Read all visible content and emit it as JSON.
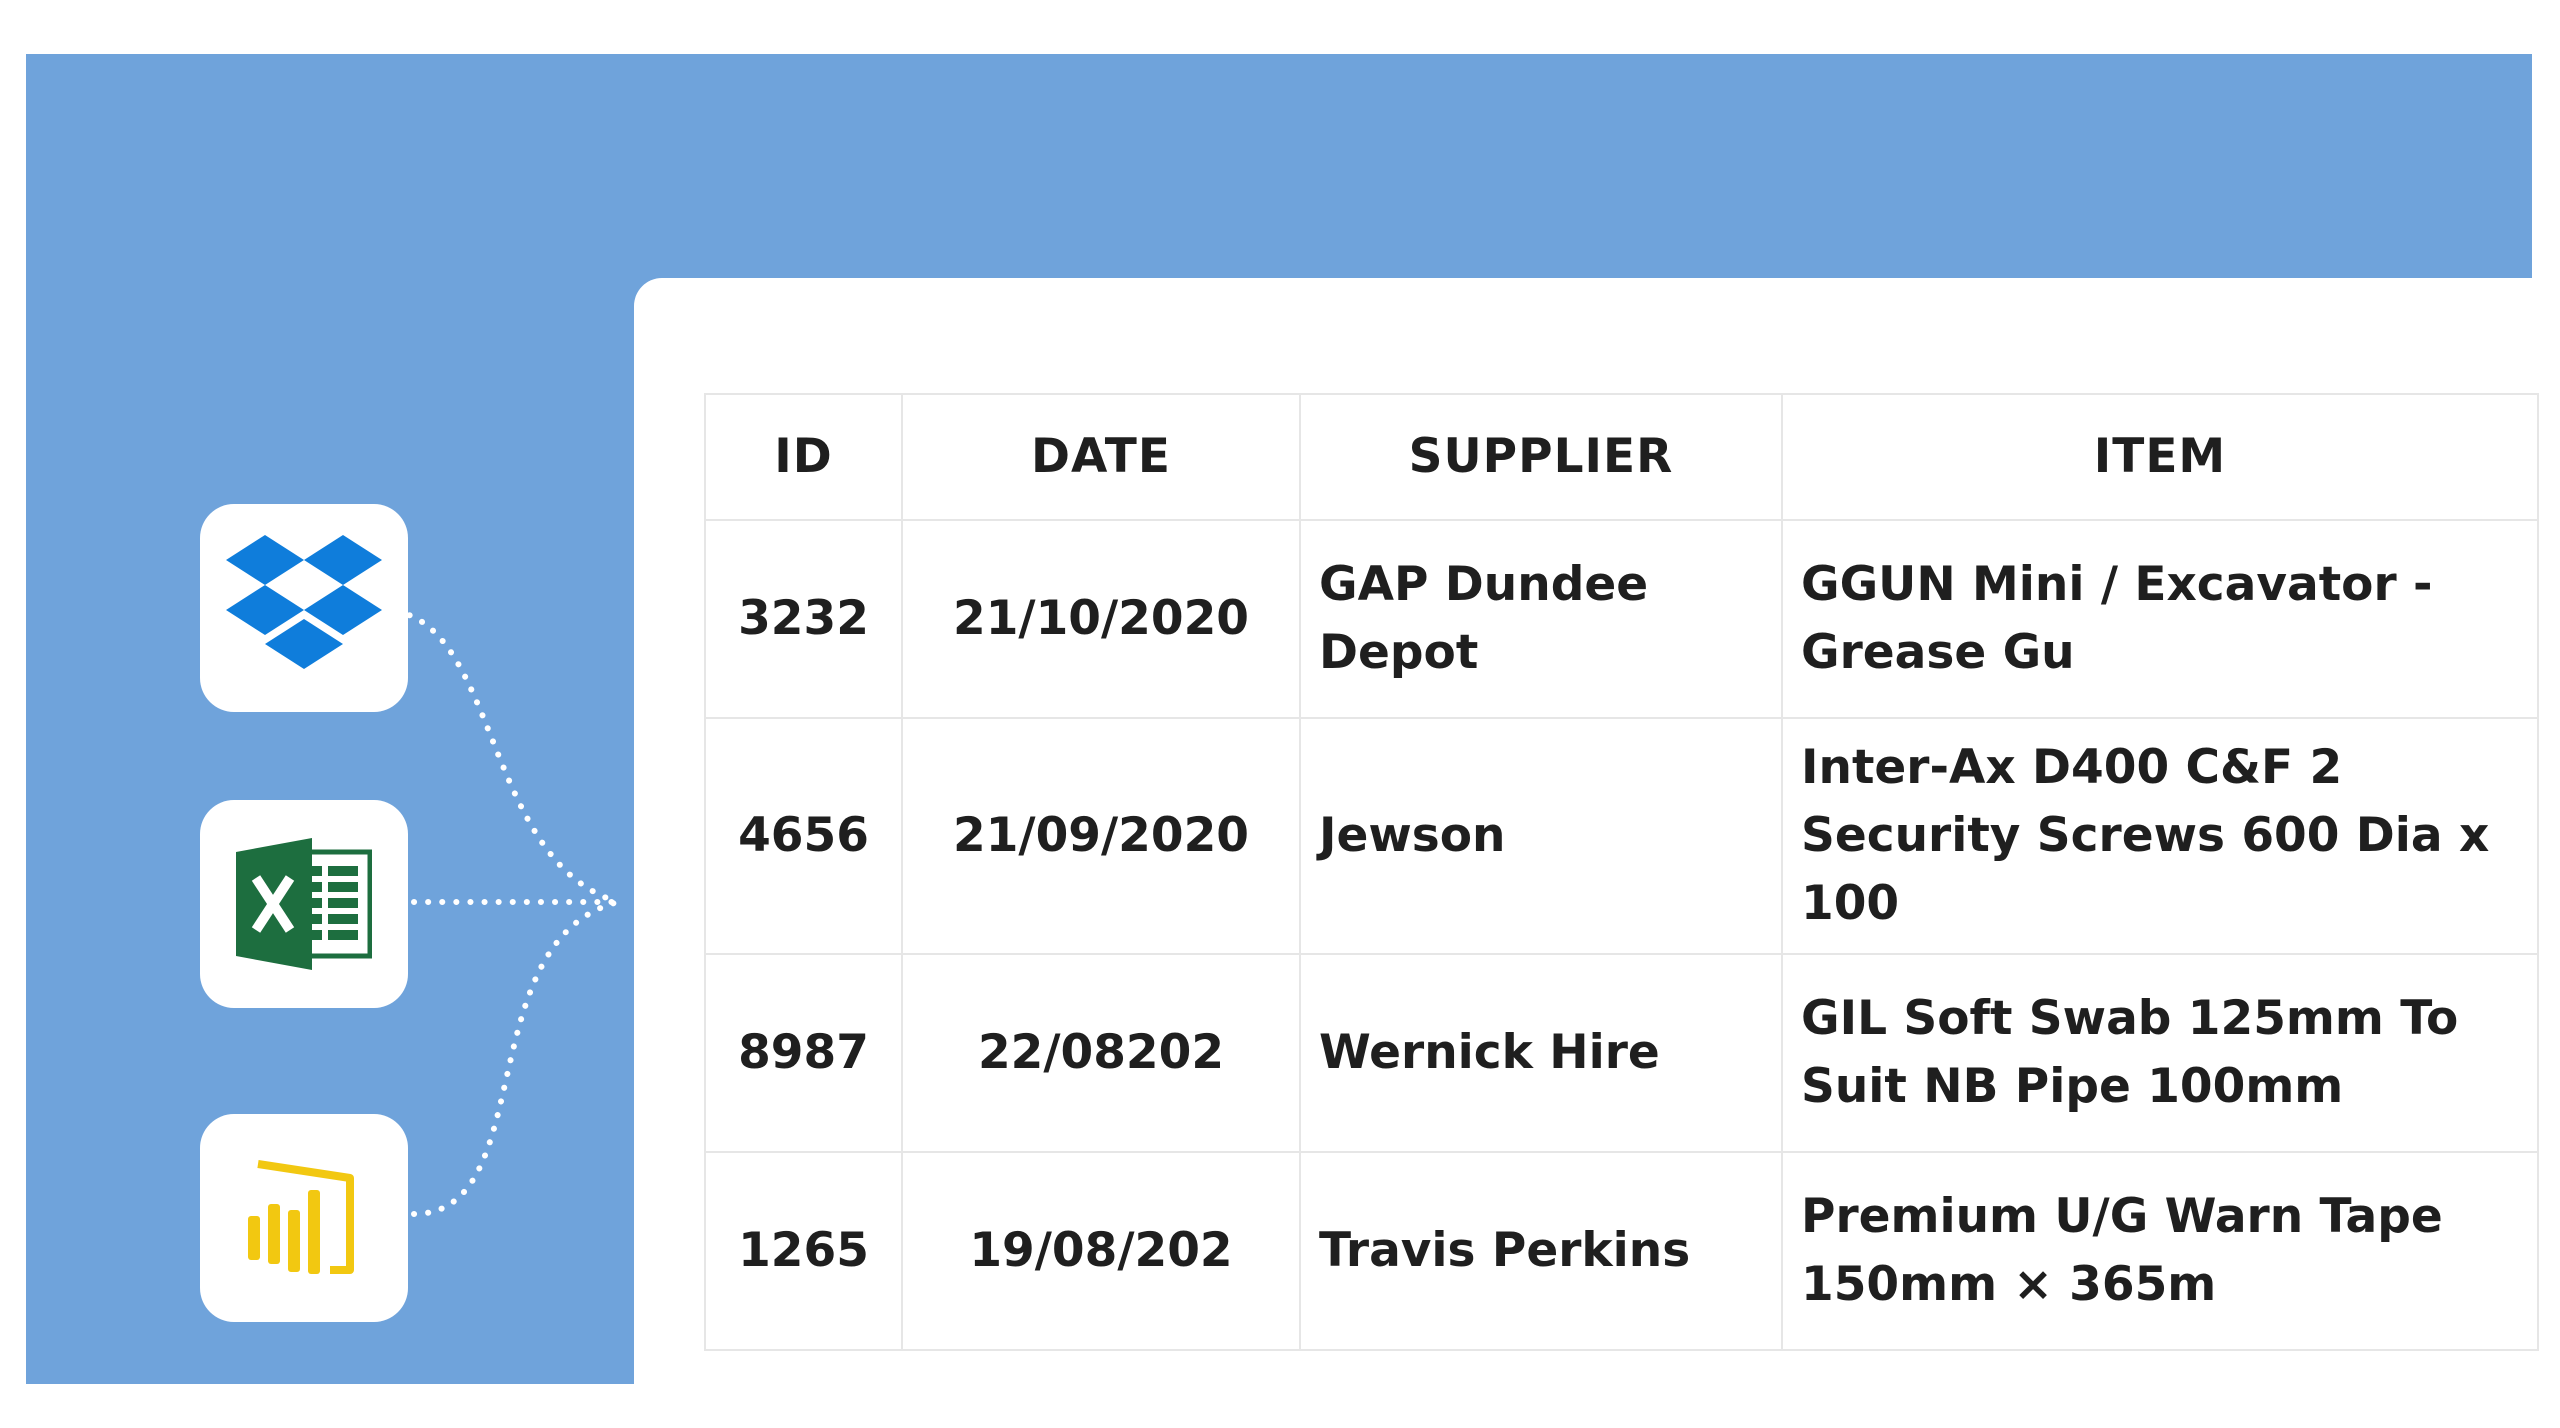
{
  "apps": [
    {
      "name": "Dropbox",
      "icon": "dropbox-icon"
    },
    {
      "name": "Excel",
      "icon": "excel-icon"
    },
    {
      "name": "Power BI",
      "icon": "powerbi-icon"
    }
  ],
  "table": {
    "headers": {
      "id": "ID",
      "date": "DATE",
      "supplier": "SUPPLIER",
      "item": "ITEM"
    },
    "rows": [
      {
        "id": "3232",
        "date": "21/10/2020",
        "supplier": "GAP Dundee Depot",
        "item": "GGUN Mini / Excavator - Grease Gu"
      },
      {
        "id": "4656",
        "date": "21/09/2020",
        "supplier": "Jewson",
        "item": "Inter-Ax D400 C&F 2 Security Screws 600 Dia x 100"
      },
      {
        "id": "8987",
        "date": "22/08202",
        "supplier": "Wernick Hire",
        "item": "GIL Soft Swab 125mm To Suit NB Pipe 100mm"
      },
      {
        "id": "1265",
        "date": "19/08/202",
        "supplier": "Travis Perkins",
        "item": "Premium U/G Warn Tape 150mm × 365m"
      }
    ]
  },
  "colors": {
    "banner": "#6fa3db",
    "dropbox": "#0f7ddb",
    "excel": "#1d6e3f",
    "powerbi": "#f2c811",
    "text": "#1f1f1f",
    "grid": "#e6e6e6"
  }
}
